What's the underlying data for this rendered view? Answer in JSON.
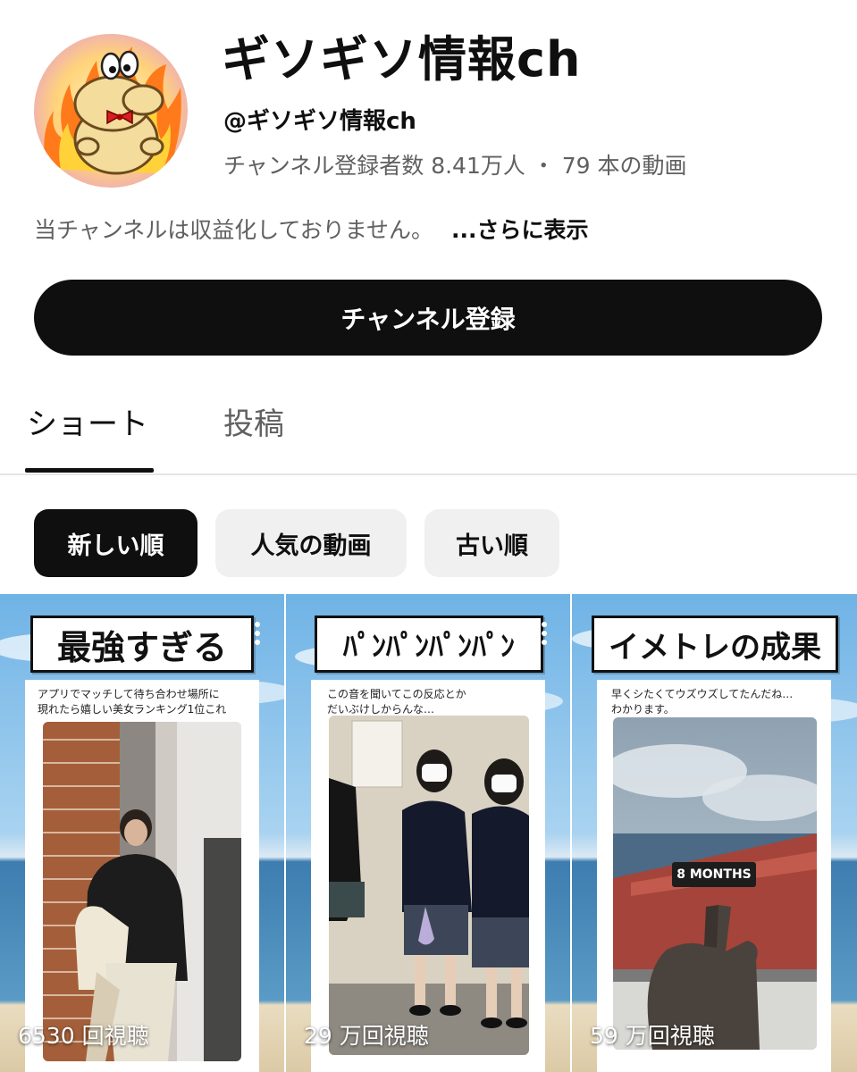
{
  "channel": {
    "title": "ギソギソ情報ch",
    "handle": "@ギソギソ情報ch",
    "stats": "チャンネル登録者数 8.41万人 ・ 79 本の動画",
    "description": "当チャンネルは収益化しておりません。",
    "more_label": "...さらに表示",
    "subscribe_label": "チャンネル登録"
  },
  "tabs": [
    {
      "label": "ショート",
      "active": true
    },
    {
      "label": "投稿",
      "active": false
    }
  ],
  "chips": [
    {
      "label": "新しい順",
      "selected": true
    },
    {
      "label": "人気の動画",
      "selected": false
    },
    {
      "label": "古い順",
      "selected": false
    }
  ],
  "shorts": [
    {
      "title": "最強すぎる",
      "caption_line1": "アプリでマッチして待ち合わせ場所に",
      "caption_line2": "現れたら嬉しい美女ランキング1位これ",
      "views": "6530 回視聴"
    },
    {
      "title": "ﾊﾟﾝﾊﾟﾝﾊﾟﾝﾊﾟﾝ",
      "caption_line1": "この音を聞いてこの反応とか",
      "caption_line2": "だいぶけしからんな…",
      "views": "29 万回視聴"
    },
    {
      "title": "イメトレの成果",
      "caption_line1": "早くシたくてウズウズしてたんだね…",
      "caption_line2": "わかります。",
      "overlay_label": "8 MONTHS",
      "views": "59 万回視聴"
    }
  ],
  "colors": {
    "primary": "#0f0f0f",
    "secondary_text": "#606060",
    "chip_bg": "#f0f0f0",
    "sky": "#8fc4ea",
    "sea": "#3f7fb0",
    "sand": "#e9dcc0"
  },
  "icons": [
    "channel-avatar-mascot",
    "more-vert-icon"
  ]
}
